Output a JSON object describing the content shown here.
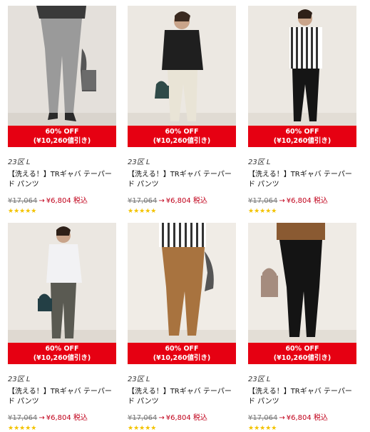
{
  "products": [
    {
      "sale": "60% OFF",
      "discount": "(¥10,260値引き)",
      "brand": "23区 L",
      "title": "【洗える！】TRギャバ テーパード パンツ",
      "old_price": "¥17,064",
      "arrow": "→",
      "new_price": "¥6,804 税込",
      "stars": "★★★★★",
      "pose": "pose-1"
    },
    {
      "sale": "60% OFF",
      "discount": "(¥10,260値引き)",
      "brand": "23区 L",
      "title": "【洗える！】TRギャバ テーパード パンツ",
      "old_price": "¥17,064",
      "arrow": "→",
      "new_price": "¥6,804 税込",
      "stars": "★★★★★",
      "pose": "pose-2"
    },
    {
      "sale": "60% OFF",
      "discount": "(¥10,260値引き)",
      "brand": "23区 L",
      "title": "【洗える！】TRギャバ テーパード パンツ",
      "old_price": "¥17,064",
      "arrow": "→",
      "new_price": "¥6,804 税込",
      "stars": "★★★★★",
      "pose": "pose-3"
    },
    {
      "sale": "60% OFF",
      "discount": "(¥10,260値引き)",
      "brand": "23区 L",
      "title": "【洗える！】TRギャバ テーパード パンツ",
      "old_price": "¥17,064",
      "arrow": "→",
      "new_price": "¥6,804 税込",
      "stars": "★★★★★",
      "pose": "pose-4"
    },
    {
      "sale": "60% OFF",
      "discount": "(¥10,260値引き)",
      "brand": "23区 L",
      "title": "【洗える！】TRギャバ テーパード パンツ",
      "old_price": "¥17,064",
      "arrow": "→",
      "new_price": "¥6,804 税込",
      "stars": "★★★★★",
      "pose": "pose-5"
    },
    {
      "sale": "60% OFF",
      "discount": "(¥10,260値引き)",
      "brand": "23区 L",
      "title": "【洗える！】TRギャバ テーパード パンツ",
      "old_price": "¥17,064",
      "arrow": "→",
      "new_price": "¥6,804 税込",
      "stars": "★★★★★",
      "pose": "pose-6"
    }
  ],
  "colors": {
    "sale_band": "#e60012",
    "price_new": "#c0001a",
    "star": "#f3c300",
    "photo_bg_1": "#e4e0db",
    "photo_bg_2": "#ece8e2",
    "photo_bg_3": "#f0ece6"
  }
}
